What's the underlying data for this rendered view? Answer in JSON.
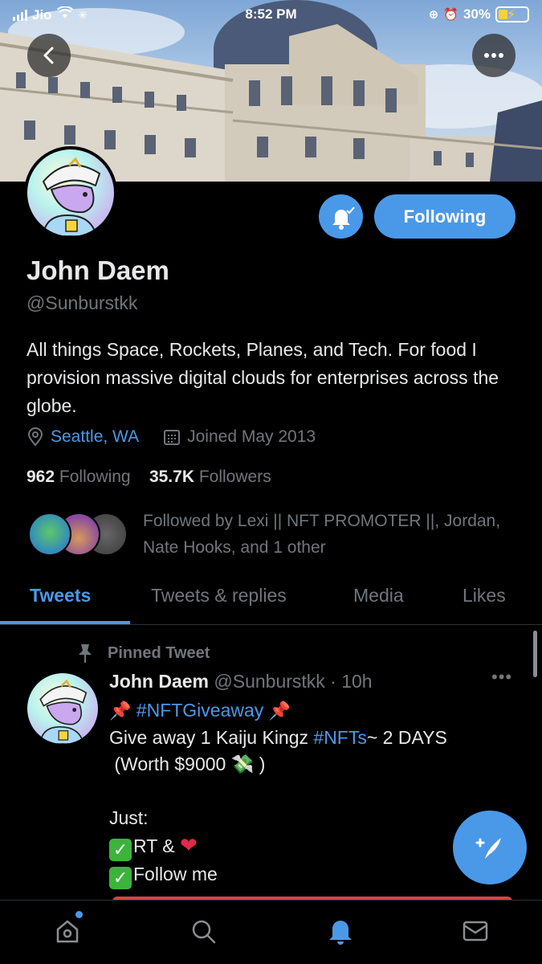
{
  "status_bar": {
    "carrier": "Jio",
    "time": "8:52 PM",
    "battery": "30%"
  },
  "header": {
    "back_icon": "chevron-left-icon",
    "more_icon": "ellipsis-icon"
  },
  "profile": {
    "name": "John Daem",
    "handle": "@Sunburstkk",
    "bio": "All things Space, Rockets, Planes, and Tech. For food I provision massive digital clouds for enterprises across the globe.",
    "location": "Seattle, WA",
    "joined": "Joined May 2013",
    "following_count": "962",
    "following_label": "Following",
    "followers_count": "35.7K",
    "followers_label": "Followers",
    "followed_by": "Followed by Lexi || NFT PROMOTER ||, Jordan, Nate Hooks, and 1 other",
    "follow_button": "Following"
  },
  "tabs": [
    "Tweets",
    "Tweets & replies",
    "Media",
    "Likes"
  ],
  "tweet": {
    "pinned_label": "Pinned Tweet",
    "author": "John Daem",
    "handle": "@Sunburstkk",
    "time": "· 10h",
    "hashtag_giveaway": "#NFTGiveaway",
    "line2_start": "Give away 1 Kaiju Kingz ",
    "hashtag_nfts": "#NFTs",
    "line2_end": "~ 2 DAYS",
    "line3": "(Worth $9000",
    "line3_end": ")",
    "line5": "Just:",
    "line6": "RT &",
    "line7": "Follow me"
  },
  "colors": {
    "accent": "#4a99e9",
    "background": "#000000",
    "muted": "#71767b"
  }
}
